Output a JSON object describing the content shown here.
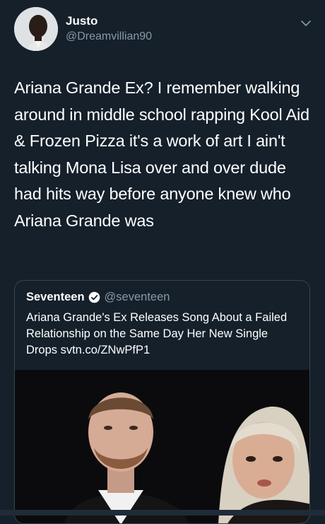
{
  "tweet": {
    "author_name": "Justo",
    "author_handle": "@Dreamvillian90",
    "text": "Ariana Grande Ex? I remember walking around in middle school rapping Kool Aid & Frozen Pizza it's a work of art I ain't talking Mona Lisa over and over dude had hits way before anyone knew who Ariana Grande was"
  },
  "quoted": {
    "author_name": "Seventeen",
    "author_handle": "@seventeen",
    "verified": true,
    "text": "Ariana Grande's Ex Releases Song About a Failed Relationship on the Same Day Her New Single Drops svtn.co/ZNwPfP1"
  },
  "icons": {
    "more": "chevron-down-icon",
    "verified": "verified-badge-icon"
  },
  "colors": {
    "background": "#15202b",
    "secondary_text": "#8899a6",
    "border": "#38444d",
    "verified": "#ffffff"
  }
}
